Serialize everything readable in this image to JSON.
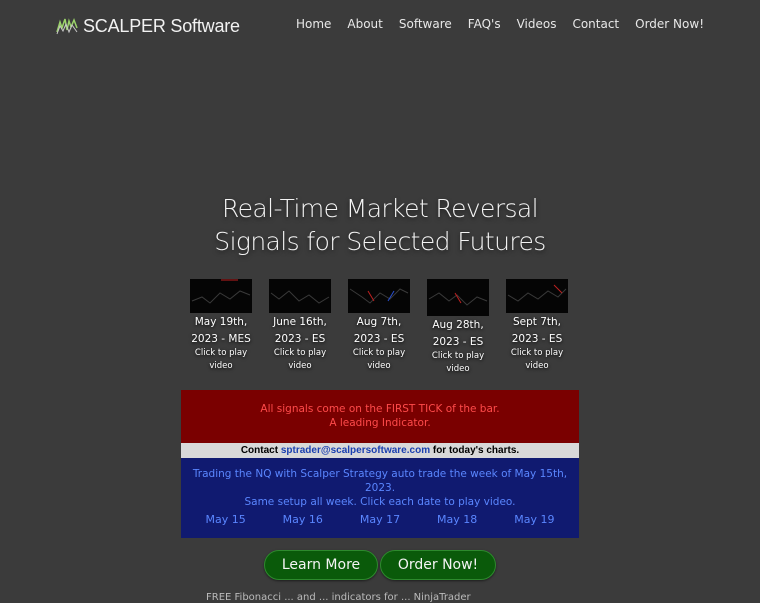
{
  "header": {
    "brand": "SCALPER Software",
    "nav": [
      "Home",
      "About",
      "Software",
      "FAQ's",
      "Videos",
      "Contact",
      "Order Now!"
    ]
  },
  "hero": {
    "headline_line1": "Real-Time Market Reversal",
    "headline_line2": "Signals for Selected Futures"
  },
  "videos": [
    {
      "line1": "May 19th,",
      "line2": "2023 - MES",
      "cta1": "Click to play",
      "cta2": "video"
    },
    {
      "line1": "June 16th,",
      "line2": "2023 - ES",
      "cta1": "Click to play",
      "cta2": "video"
    },
    {
      "line1": "Aug 7th,",
      "line2": "2023 - ES",
      "cta1": "Click to play",
      "cta2": "video"
    },
    {
      "line1": "Aug 28th,",
      "line2": "2023 - ES",
      "cta1": "Click to play",
      "cta2": "video"
    },
    {
      "line1": "Sept 7th,",
      "line2": "2023 - ES",
      "cta1": "Click to play",
      "cta2": "video"
    }
  ],
  "banner": {
    "red_line1": "All signals come on the FIRST TICK of the bar.",
    "red_line2": "A leading Indicator.",
    "contact_prefix": "Contact ",
    "contact_email": "sptrader@scalpersoftware.com",
    "contact_suffix": " for today's charts.",
    "blue_line1": "Trading the NQ with Scalper Strategy auto trade the week of May 15th, 2023.",
    "blue_line2": "Same setup all week. Click each date to play video.",
    "days": [
      "May 15",
      "May 16",
      "May 17",
      "May 18",
      "May 19"
    ]
  },
  "buttons": {
    "learn_more": "Learn More",
    "order_now": "Order Now!"
  },
  "footer": {
    "partial_text": "FREE Fibonacci ... and ... indicators for ... NinjaTrader"
  },
  "colors": {
    "background": "#3b3b3b",
    "banner_red": "#7a0000",
    "banner_blue": "#101a70",
    "button_green": "#0a5a0a"
  }
}
